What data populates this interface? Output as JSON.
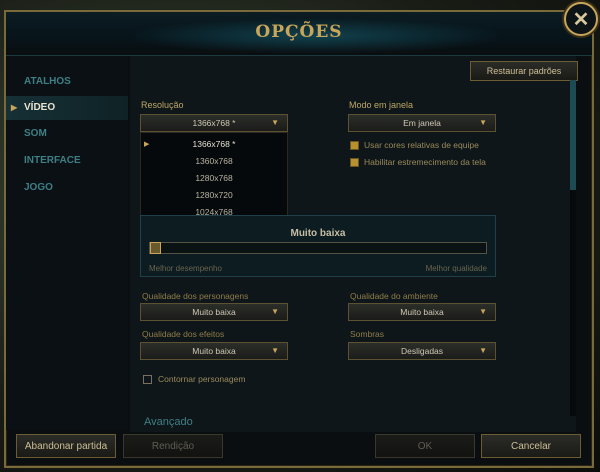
{
  "window": {
    "title": "OPÇÕES"
  },
  "sidebar": {
    "items": [
      {
        "label": "ATALHOS",
        "active": false
      },
      {
        "label": "VÍDEO",
        "active": true
      },
      {
        "label": "SOM",
        "active": false
      },
      {
        "label": "INTERFACE",
        "active": false
      },
      {
        "label": "JOGO",
        "active": false
      }
    ]
  },
  "content": {
    "restore_defaults_label": "Restaurar padrões",
    "resolution": {
      "label": "Resolução",
      "selected": "1366x768 *",
      "options": [
        "1366x768 *",
        "1360x768",
        "1280x768",
        "1280x720",
        "1024x768"
      ],
      "highlighted_index": 0
    },
    "window_mode": {
      "label": "Modo em janela",
      "selected": "Em janela"
    },
    "checkboxes": [
      {
        "label": "Usar cores relativas de equipe",
        "checked": true
      },
      {
        "label": "Habilitar estremecimento da tela",
        "checked": true
      }
    ],
    "preset": {
      "value_label": "Muito baixa",
      "left_caption": "Melhor desempenho",
      "right_caption": "Melhor qualidade",
      "level_fraction": 0.0
    },
    "quality": {
      "characters_label": "Qualidade dos personagens",
      "characters_value": "Muito baixa",
      "environment_label": "Qualidade do ambiente",
      "environment_value": "Muito baixa",
      "effects_label": "Qualidade dos efeitos",
      "effects_value": "Muito baixa",
      "shadows_label": "Sombras",
      "shadows_value": "Desligadas"
    },
    "outline": {
      "label": "Contornar personagem",
      "checked": false
    },
    "advanced_label": "Avançado"
  },
  "footer": {
    "abandon_label": "Abandonar partida",
    "surrender_label": "Rendição",
    "ok_label": "OK",
    "cancel_label": "Cancelar"
  },
  "colors": {
    "gold": "#c8a55a",
    "teal": "#3e7f86",
    "panel": "#0e1619"
  }
}
